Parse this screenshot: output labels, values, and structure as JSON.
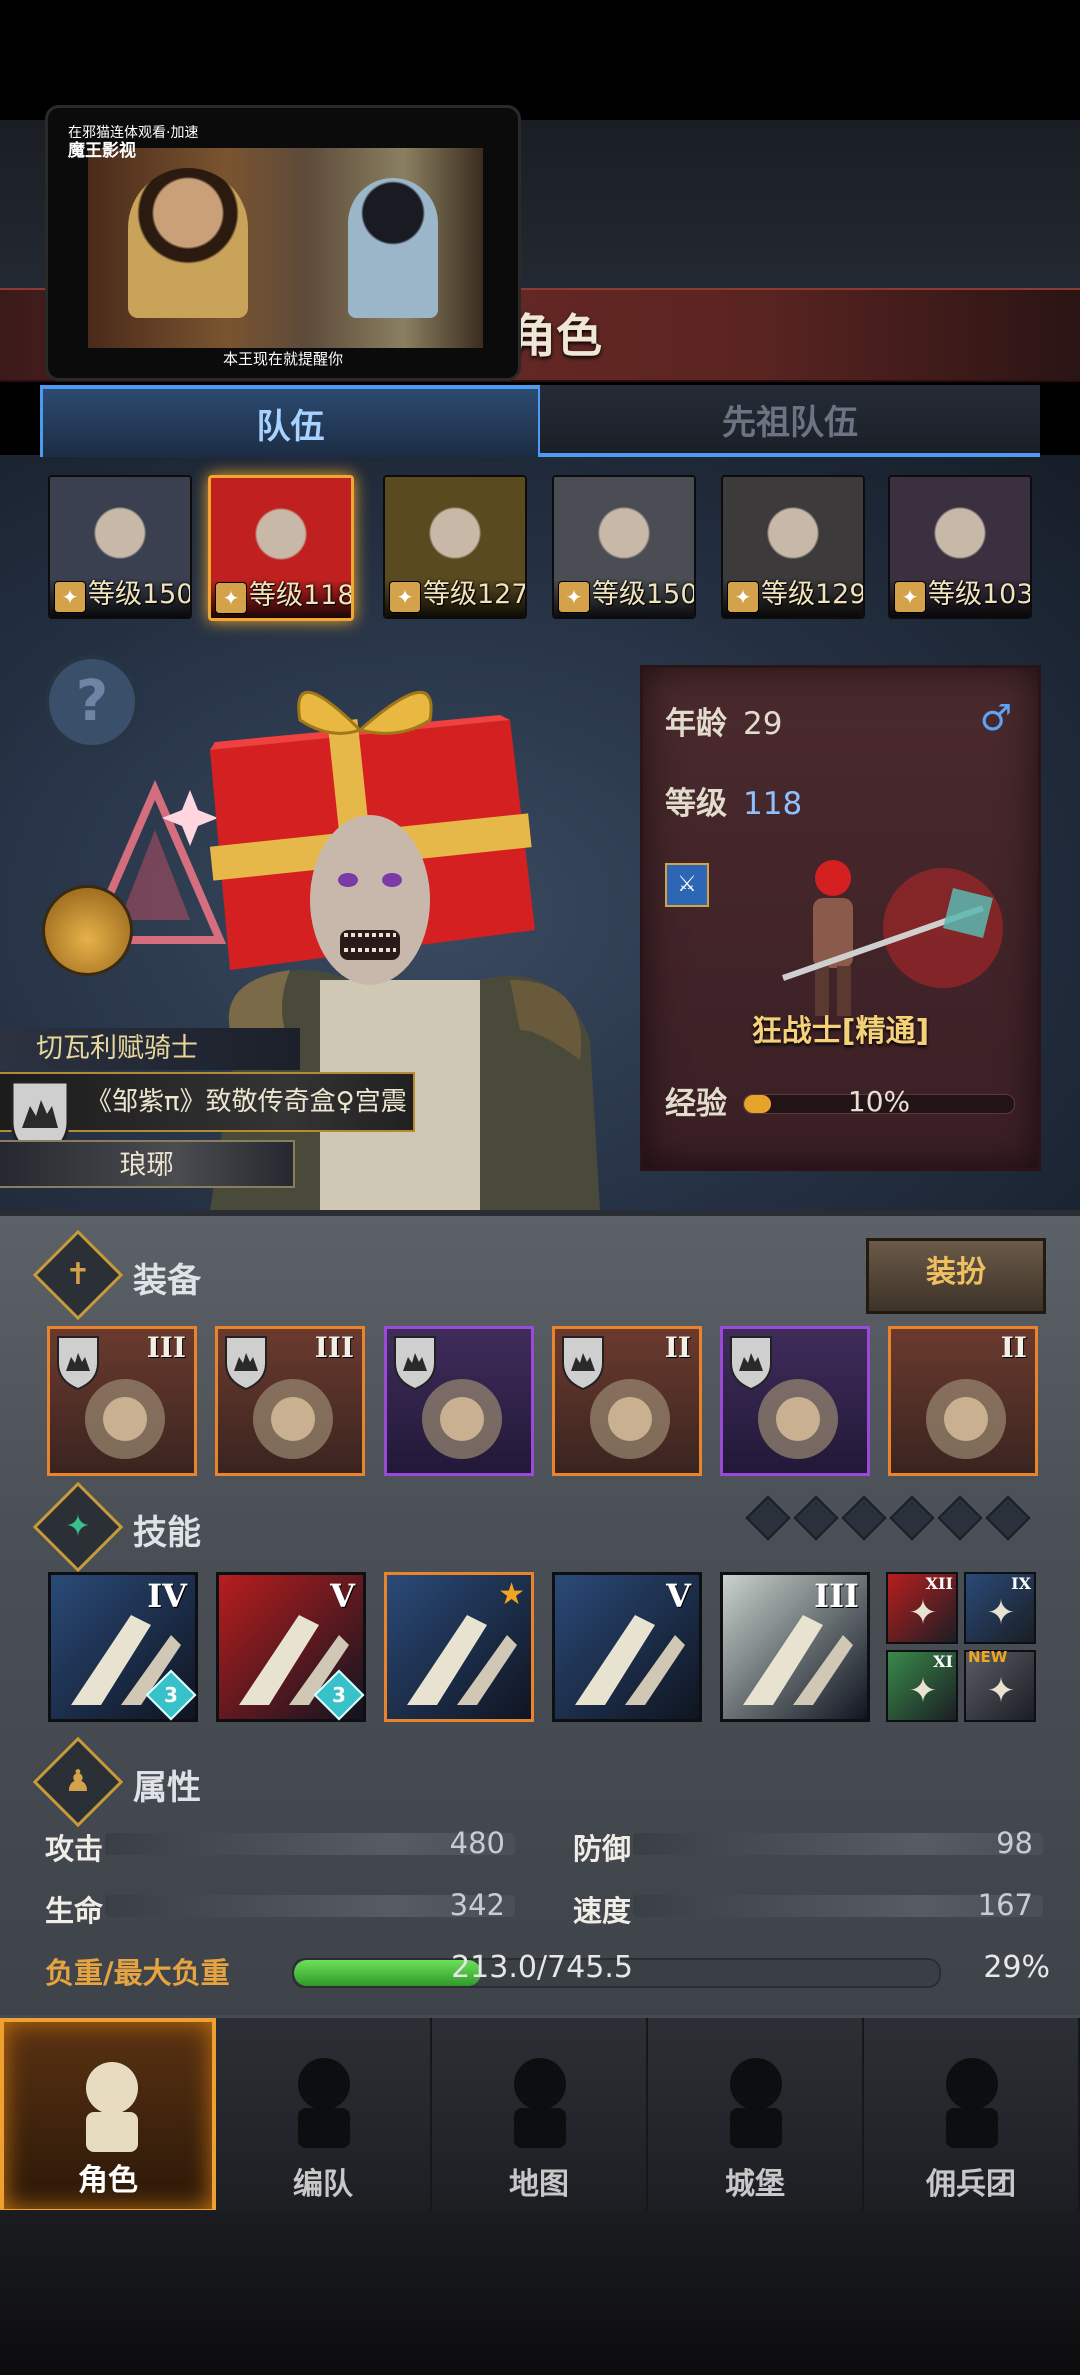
{
  "video": {
    "top_caption": "在邪猫连体观看·加速",
    "logo": "魔王影视",
    "subtitle": "本王现在就提醒你"
  },
  "page_title": "角色",
  "tabs": [
    {
      "label": "队伍",
      "active": true
    },
    {
      "label": "先祖队伍",
      "active": false
    }
  ],
  "heroes": [
    {
      "level": "等级150",
      "class_icon": "shield-icon",
      "selected": false
    },
    {
      "level": "等级118",
      "class_icon": "sword-icon",
      "selected": true
    },
    {
      "level": "等级127",
      "class_icon": "horse-icon",
      "selected": false
    },
    {
      "level": "等级150",
      "class_icon": "bow-icon",
      "selected": false
    },
    {
      "level": "等级129",
      "class_icon": "staff-icon",
      "selected": false
    },
    {
      "level": "等级103",
      "class_icon": "staff-icon",
      "selected": false
    }
  ],
  "character": {
    "title": "切瓦利赋骑士",
    "guild_text": "《邹紫π》致敬传奇盒♀宫震",
    "guild_name": "琅琊"
  },
  "info_card": {
    "age_label": "年龄",
    "age": "29",
    "gender_symbol": "♂",
    "level_label": "等级",
    "level": "118",
    "class_name": "狂战士[精通]",
    "exp_label": "经验",
    "exp_percent": "10%",
    "exp_fraction": 0.1
  },
  "equipment": {
    "title": "装备",
    "dress_button": "装扮",
    "items": [
      {
        "tier": "III",
        "rarity": "orange",
        "name": "spiked-pauldron-icon",
        "has_shield": true
      },
      {
        "tier": "III",
        "rarity": "orange",
        "name": "spiked-pauldron-icon",
        "has_shield": true
      },
      {
        "tier": "",
        "rarity": "purple",
        "name": "helmet-icon",
        "has_shield": true
      },
      {
        "tier": "II",
        "rarity": "orange",
        "name": "fur-armor-icon",
        "has_shield": true
      },
      {
        "tier": "",
        "rarity": "purple",
        "name": "boots-icon",
        "has_shield": true
      },
      {
        "tier": "II",
        "rarity": "orange",
        "name": "horn-amulet-icon",
        "has_shield": false
      }
    ]
  },
  "skills": {
    "title": "技能",
    "slots_total": 6,
    "items": [
      {
        "tier": "IV",
        "gem": "3",
        "bg": "#2a4a78",
        "name": "blade-slash-icon"
      },
      {
        "tier": "V",
        "gem": "3",
        "bg": "#b81e1e",
        "name": "whirlwind-icon"
      },
      {
        "tier": "",
        "gem": "",
        "bg": "#2a4a78",
        "name": "claw-strike-icon",
        "star": true
      },
      {
        "tier": "V",
        "gem": "",
        "bg": "#2a4a78",
        "name": "crystal-sword-icon"
      },
      {
        "tier": "III",
        "gem": "",
        "bg": "#c9d2cc",
        "name": "crystal-arm-icon"
      }
    ],
    "mini": [
      {
        "tier": "XII",
        "bg": "#b81e1e",
        "name": "sword-icon",
        "new": ""
      },
      {
        "tier": "IX",
        "bg": "#2a4a78",
        "name": "burst-icon",
        "new": ""
      },
      {
        "tier": "XI",
        "bg": "#3a8a4a",
        "name": "arm-icon",
        "new": ""
      },
      {
        "tier": "",
        "bg": "#5a5e64",
        "name": "cross-icon",
        "new": "NEW"
      }
    ]
  },
  "attributes": {
    "title": "属性",
    "attack_label": "攻击",
    "attack": "480",
    "defense_label": "防御",
    "defense": "98",
    "hp_label": "生命",
    "hp": "342",
    "speed_label": "速度",
    "speed": "167",
    "load_label": "负重/最大负重",
    "load_text": "213.0/745.5",
    "load_percent": "29%",
    "load_fraction": 0.29
  },
  "nav": [
    {
      "label": "角色",
      "icon": "knight-icon",
      "active": true
    },
    {
      "label": "编队",
      "icon": "helmet-icon",
      "active": false
    },
    {
      "label": "地图",
      "icon": "compass-map-icon",
      "active": false
    },
    {
      "label": "城堡",
      "icon": "castle-icon",
      "active": false
    },
    {
      "label": "佣兵团",
      "icon": "banner-icon",
      "active": false
    }
  ],
  "colors": {
    "accent_gold": "#f0a830",
    "tab_blue": "#4d9af0",
    "rarity_orange": "#e7842c",
    "rarity_purple": "#9a4ad6",
    "load_green": "#2e9a2a"
  }
}
